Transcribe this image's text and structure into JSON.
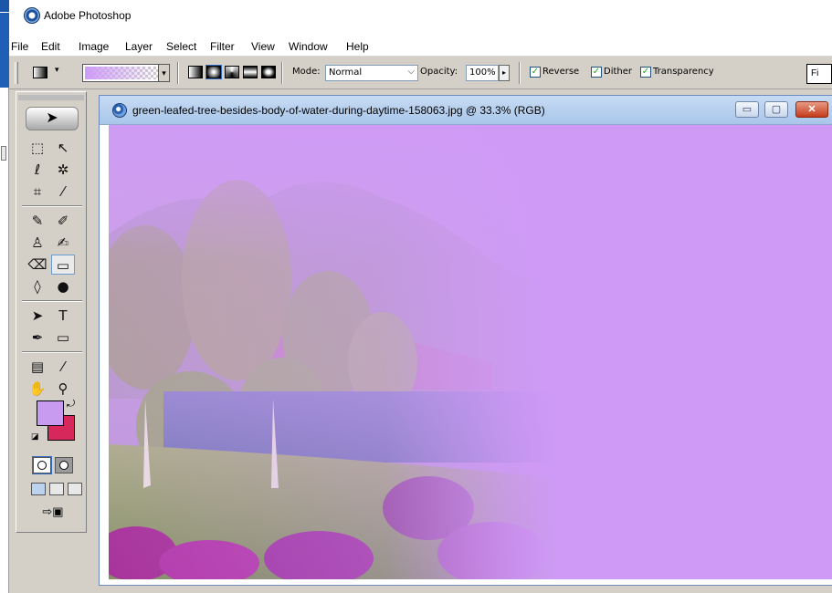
{
  "app": {
    "title": "Adobe Photoshop"
  },
  "menu": [
    "File",
    "Edit",
    "Image",
    "Layer",
    "Select",
    "Filter",
    "View",
    "Window",
    "Help"
  ],
  "options": {
    "mode_label": "Mode:",
    "mode_value": "Normal",
    "opacity_label": "Opacity:",
    "opacity_value": "100%",
    "reverse_label": "Reverse",
    "dither_label": "Dither",
    "transparency_label": "Transparency",
    "reverse_checked": true,
    "dither_checked": true,
    "transparency_checked": true,
    "palette_well_label": "Fi"
  },
  "toolbox": {
    "foreground_color": "#c89af0",
    "background_color": "#d6285a",
    "active_tool": "gradient-tool"
  },
  "document": {
    "title": "green-leafed-tree-besides-body-of-water-during-daytime-158063.jpg @ 33.3% (RGB)",
    "minimize_glyph": "▭",
    "maximize_glyph": "▢",
    "close_glyph": "✕"
  },
  "colors": {
    "overlay_purple": "#cf9af6",
    "titlebar_blue": "#b8d1ef"
  }
}
